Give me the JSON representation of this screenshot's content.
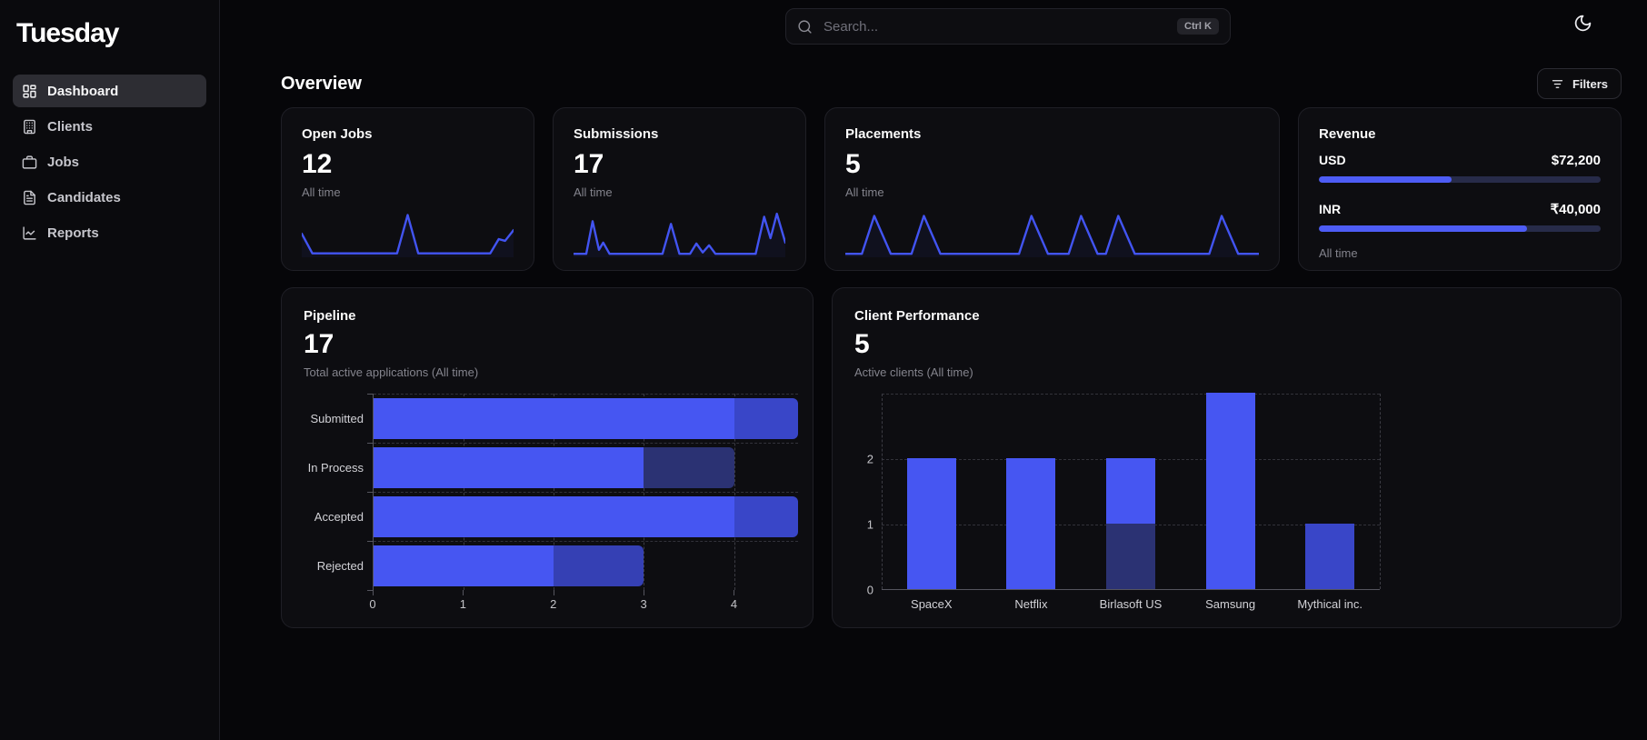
{
  "app": {
    "name": "Tuesday"
  },
  "sidebar": {
    "items": [
      {
        "label": "Dashboard",
        "icon": "dashboard-icon",
        "active": true
      },
      {
        "label": "Clients",
        "icon": "building-icon",
        "active": false
      },
      {
        "label": "Jobs",
        "icon": "briefcase-icon",
        "active": false
      },
      {
        "label": "Candidates",
        "icon": "document-icon",
        "active": false
      },
      {
        "label": "Reports",
        "icon": "chart-icon",
        "active": false
      }
    ]
  },
  "topbar": {
    "search_placeholder": "Search...",
    "shortcut": "Ctrl K"
  },
  "page": {
    "title": "Overview",
    "filters_label": "Filters"
  },
  "stats": [
    {
      "title": "Open Jobs",
      "value": "12",
      "caption": "All time",
      "spark": [
        [
          0,
          50
        ],
        [
          5,
          6
        ],
        [
          45,
          6
        ],
        [
          50,
          92
        ],
        [
          55,
          6
        ],
        [
          84,
          6
        ],
        [
          89,
          6
        ],
        [
          93,
          38
        ],
        [
          96,
          34
        ],
        [
          100,
          58
        ]
      ]
    },
    {
      "title": "Submissions",
      "value": "17",
      "caption": "All time",
      "spark": [
        [
          0,
          5
        ],
        [
          6,
          5
        ],
        [
          9,
          78
        ],
        [
          12,
          14
        ],
        [
          14,
          30
        ],
        [
          17,
          5
        ],
        [
          42,
          5
        ],
        [
          46,
          72
        ],
        [
          50,
          5
        ],
        [
          55,
          5
        ],
        [
          58,
          28
        ],
        [
          61,
          8
        ],
        [
          64,
          24
        ],
        [
          67,
          5
        ],
        [
          86,
          5
        ],
        [
          90,
          88
        ],
        [
          93,
          40
        ],
        [
          96,
          95
        ],
        [
          100,
          30
        ]
      ]
    },
    {
      "title": "Placements",
      "value": "5",
      "caption": "All time",
      "spark": [
        [
          0,
          5
        ],
        [
          4,
          5
        ],
        [
          7,
          90
        ],
        [
          11,
          5
        ],
        [
          16,
          5
        ],
        [
          19,
          90
        ],
        [
          23,
          5
        ],
        [
          42,
          5
        ],
        [
          45,
          90
        ],
        [
          49,
          5
        ],
        [
          54,
          5
        ],
        [
          57,
          90
        ],
        [
          61,
          5
        ],
        [
          63,
          5
        ],
        [
          66,
          90
        ],
        [
          70,
          5
        ],
        [
          88,
          5
        ],
        [
          91,
          90
        ],
        [
          95,
          5
        ],
        [
          100,
          5
        ]
      ]
    }
  ],
  "revenue": {
    "title": "Revenue",
    "caption": "All time",
    "rows": [
      {
        "currency": "USD",
        "amount": "$72,200",
        "pct": 47
      },
      {
        "currency": "INR",
        "amount": "₹40,000",
        "pct": 74
      }
    ]
  },
  "pipeline_card": {
    "title": "Pipeline",
    "value": "17",
    "caption": "Total active applications (All time)"
  },
  "clients_card": {
    "title": "Client Performance",
    "value": "5",
    "caption": "Active clients (All time)"
  },
  "chart_data": [
    {
      "type": "bar",
      "orientation": "horizontal",
      "title": "Pipeline",
      "categories": [
        "Submitted",
        "In Process",
        "Accepted",
        "Rejected"
      ],
      "series": [
        {
          "name": "primary",
          "values": [
            4,
            3,
            4,
            2
          ],
          "color": "#4656f2"
        },
        {
          "name": "secondary",
          "values": [
            1,
            1,
            1,
            1
          ],
          "colors": [
            "#3946c8",
            "#2b3273",
            "#3946c8",
            "#3540b4"
          ]
        }
      ],
      "totals": [
        5,
        4,
        5,
        3
      ],
      "x_ticks": [
        0,
        1,
        2,
        3,
        4
      ],
      "xlim": [
        0,
        4.71
      ],
      "grid": "dashed"
    },
    {
      "type": "bar",
      "orientation": "vertical",
      "title": "Client Performance",
      "categories": [
        "SpaceX",
        "Netflix",
        "Birlasoft US",
        "Samsung",
        "Mythical inc."
      ],
      "series": [
        {
          "name": "base",
          "values": [
            0,
            0,
            1,
            0,
            0
          ],
          "color": "#2b3273"
        },
        {
          "name": "main",
          "values": [
            2,
            2,
            1,
            3,
            1
          ],
          "colors": [
            "#4656f2",
            "#4656f2",
            "#4656f2",
            "#4656f2",
            "#3946c8"
          ]
        }
      ],
      "totals": [
        2,
        2,
        2,
        3,
        1
      ],
      "y_ticks": [
        0,
        1,
        2
      ],
      "ylim": [
        0,
        3
      ],
      "grid": "dashed"
    }
  ],
  "colors": {
    "accent": "#4656f2",
    "accent_dark": "#2b3273",
    "accent_mid": "#3946c8",
    "spark_line": "#4254f2",
    "progress_fill": "#4d5cf5",
    "progress_track": "#272b49",
    "grid_line": "#3c3c44",
    "axis_line": "#55555e"
  }
}
